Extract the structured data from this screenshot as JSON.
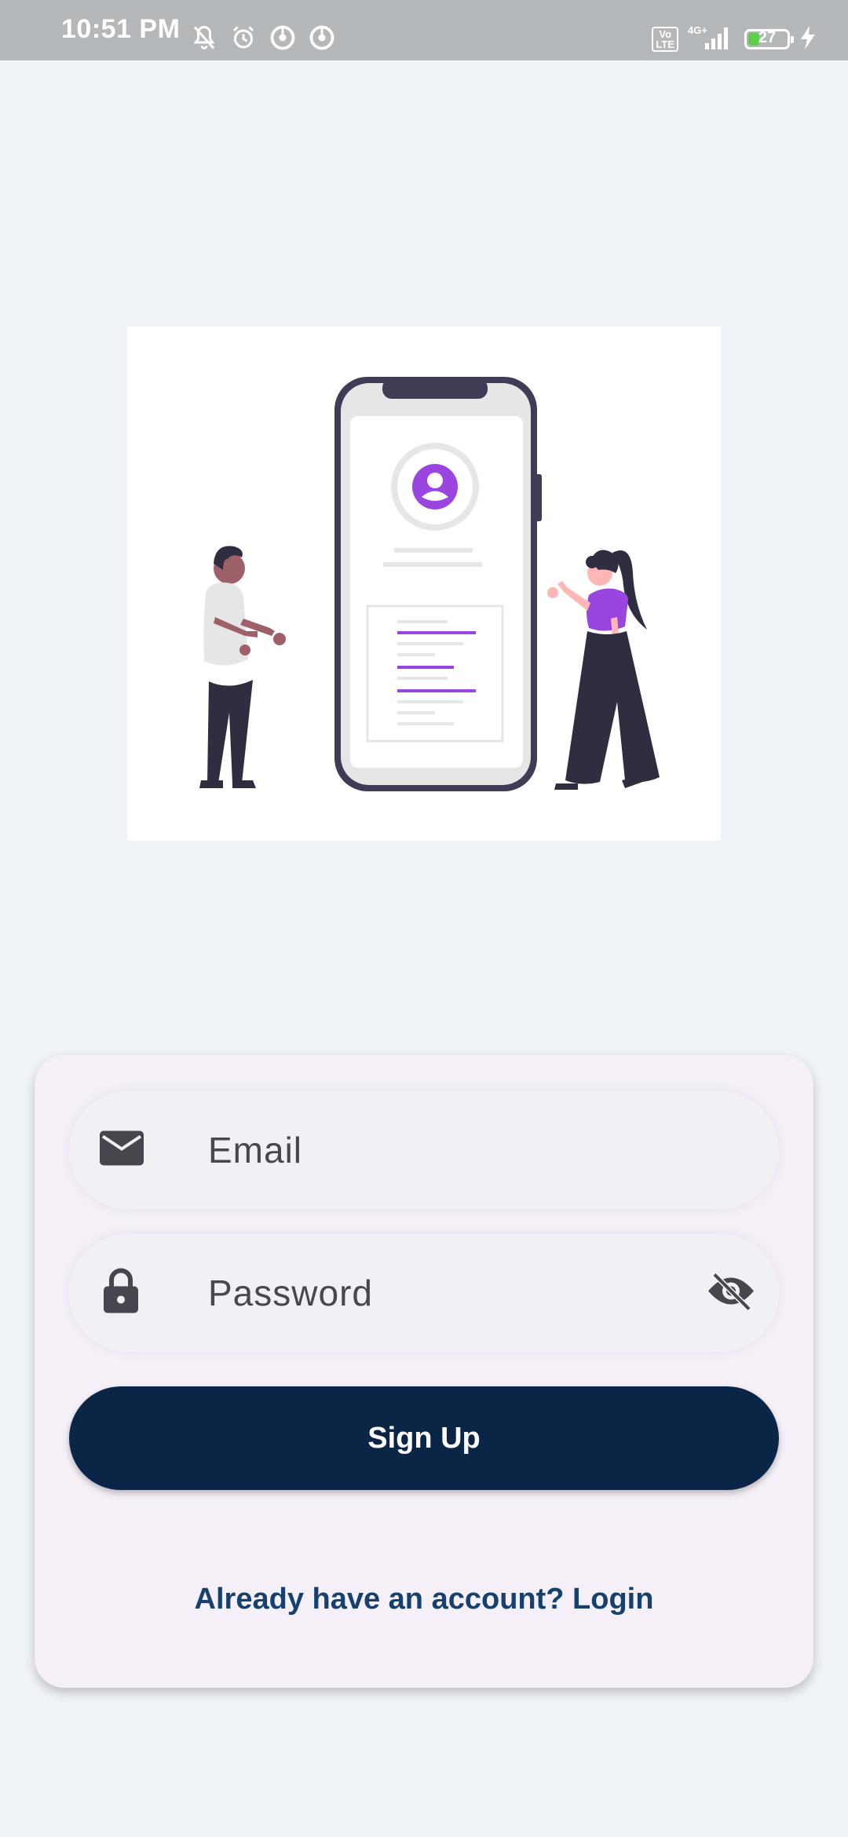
{
  "status_bar": {
    "time": "10:51 PM",
    "volte_label": "Vo\nLTE",
    "network": "4G+",
    "battery": "27",
    "icons": [
      "mute-bell-icon",
      "alarm-icon",
      "data-saver-icon",
      "data-saver-icon",
      "charging-icon"
    ]
  },
  "illustration": {
    "description_icon": "signup-illustration"
  },
  "form": {
    "email_placeholder": "Email",
    "password_placeholder": "Password",
    "signup_label": "Sign Up",
    "login_link": "Already have an account? Login"
  },
  "colors": {
    "background": "#f0f4f8",
    "card": "#f5f0f8",
    "button": "#0b2547",
    "link": "#16406e",
    "accent_purple": "#9b45e0",
    "dark_figure": "#3f3d56"
  }
}
